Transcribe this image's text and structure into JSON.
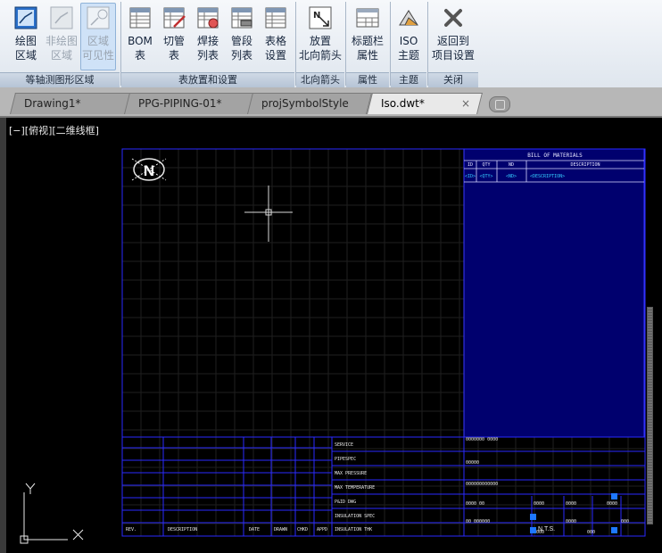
{
  "ribbon": {
    "panels": [
      {
        "title": "等轴测图形区域",
        "buttons": [
          {
            "label": "绘图\n区域",
            "icon": "draw-area-icon",
            "state": "normal"
          },
          {
            "label": "非绘图\n区域",
            "icon": "non-draw-area-icon",
            "state": "disabled"
          },
          {
            "label": "区域\n可见性",
            "icon": "area-visibility-icon",
            "state": "active-disabled"
          }
        ]
      },
      {
        "title": "表放置和设置",
        "buttons": [
          {
            "label": "BOM\n表",
            "icon": "bom-table-icon"
          },
          {
            "label": "切管\n表",
            "icon": "cut-pipe-table-icon"
          },
          {
            "label": "焊接\n列表",
            "icon": "weld-list-icon"
          },
          {
            "label": "管段\n列表",
            "icon": "spool-list-icon"
          },
          {
            "label": "表格\n设置",
            "icon": "table-settings-icon"
          }
        ]
      },
      {
        "title": "北向箭头",
        "buttons": [
          {
            "label": "放置\n北向箭头",
            "icon": "north-arrow-icon"
          }
        ]
      },
      {
        "title": "属性",
        "buttons": [
          {
            "label": "标题栏\n属性",
            "icon": "title-block-icon"
          }
        ]
      },
      {
        "title": "主题",
        "buttons": [
          {
            "label": "ISO\n主题",
            "icon": "iso-theme-icon"
          }
        ]
      },
      {
        "title": "关闭",
        "buttons": [
          {
            "label": "返回到\n项目设置",
            "icon": "close-x-icon"
          }
        ]
      }
    ]
  },
  "tabs": [
    {
      "label": "Drawing1*",
      "active": false
    },
    {
      "label": "PPG-PIPING-01*",
      "active": false
    },
    {
      "label": "projSymbolStyle",
      "active": false
    },
    {
      "label": "Iso.dwt*",
      "active": true,
      "close": "×"
    }
  ],
  "viewport": {
    "view_label": "[−][俯视][二维线框]",
    "north_letter": "N",
    "bom": {
      "title": "BILL OF MATERIALS",
      "headers": [
        "ID",
        "QTY",
        "ND",
        "DESCRIPTION"
      ],
      "row": [
        "<ID>",
        "<QTY>",
        "<ND>",
        "<DESCRIPTION>"
      ]
    },
    "title_block": {
      "fields": [
        "SERVICE",
        "PIPESPEC",
        "MAX PRESSURE",
        "MAX TEMPERATURE",
        "P&ID DWG",
        "INSULATION SPEC",
        "INSULATION THK"
      ],
      "revision_headers": [
        "REV.",
        "DESCRIPTION",
        "DATE",
        "DRAWN",
        "CHKD",
        "APPD"
      ],
      "scale": "N.T.S.",
      "placeholders": [
        "0000000 0000",
        "00000",
        "000000000000",
        "0000 00",
        "0000",
        "0000",
        "0000",
        "00 000000",
        "0000",
        "000",
        "0000",
        "000"
      ]
    },
    "ucs": {
      "y": "Y",
      "x": "X"
    }
  },
  "colors": {
    "ribbon_bg": "#dfe6ee",
    "viewport_bg": "#000000",
    "bom_fill": "#00006e",
    "frame_blue": "#2a2aff",
    "text_cyan": "#33ccff"
  }
}
